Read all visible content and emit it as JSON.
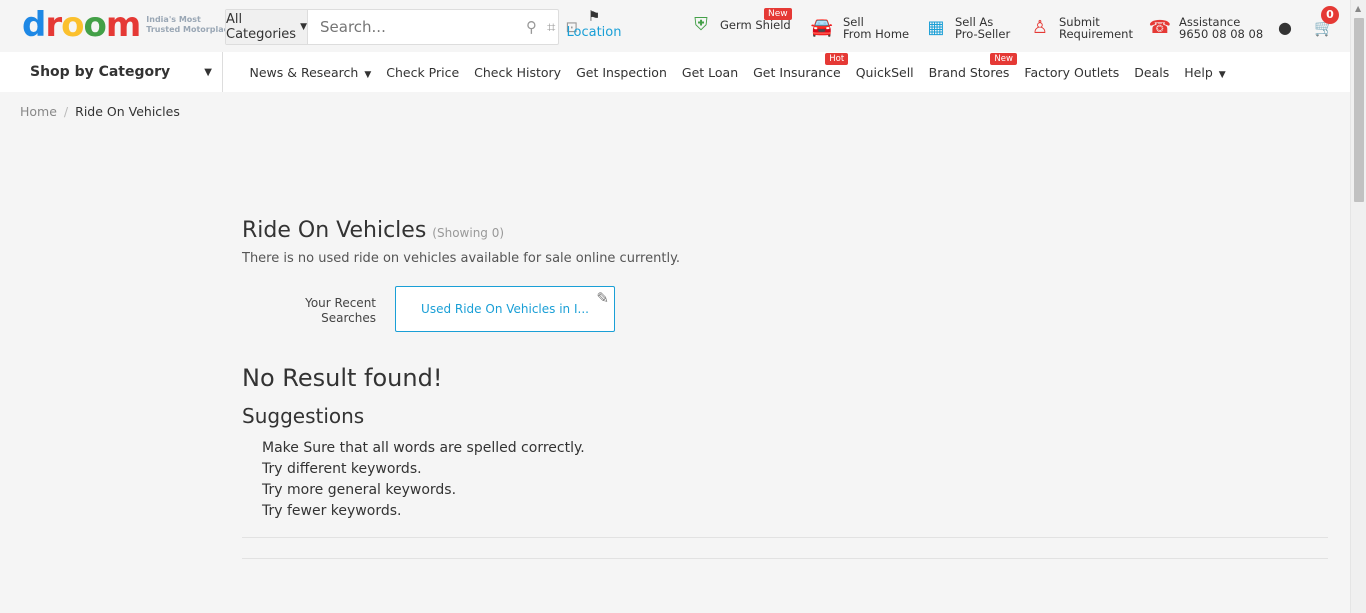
{
  "header": {
    "logo_text": "droom",
    "logo_tagline": "India's Most Trusted Motorplace",
    "search": {
      "category_label": "All Categories",
      "placeholder": "Search..."
    },
    "location_label": "Location",
    "items": [
      {
        "line1": "Germ Shield",
        "line2": "",
        "badge": "New"
      },
      {
        "line1": "Sell",
        "line2": "From Home",
        "badge": ""
      },
      {
        "line1": "Sell As",
        "line2": "Pro-Seller",
        "badge": ""
      },
      {
        "line1": "Submit",
        "line2": "Requirement",
        "badge": ""
      },
      {
        "line1": "Assistance",
        "line2": "9650 08 08 08",
        "badge": ""
      }
    ],
    "cart_count": "0"
  },
  "nav": {
    "shop_by_category": "Shop by Category",
    "items": [
      {
        "label": "News & Research",
        "badge": ""
      },
      {
        "label": "Check Price",
        "badge": ""
      },
      {
        "label": "Check History",
        "badge": ""
      },
      {
        "label": "Get Inspection",
        "badge": ""
      },
      {
        "label": "Get Loan",
        "badge": ""
      },
      {
        "label": "Get Insurance",
        "badge": "Hot"
      },
      {
        "label": "QuickSell",
        "badge": ""
      },
      {
        "label": "Brand Stores",
        "badge": "New"
      },
      {
        "label": "Factory Outlets",
        "badge": ""
      },
      {
        "label": "Deals",
        "badge": ""
      },
      {
        "label": "Help",
        "badge": ""
      }
    ]
  },
  "breadcrumb": {
    "home": "Home",
    "separator": "/",
    "current": "Ride On Vehicles"
  },
  "main": {
    "title": "Ride On Vehicles",
    "showing": "(Showing 0)",
    "subtext": "There is no used ride on vehicles available for sale online currently.",
    "recent_label": "Your Recent Searches",
    "recent_search": "Used Ride On Vehicles in I...",
    "no_result": "No Result found!",
    "suggestions_title": "Suggestions",
    "suggestions": [
      "Make Sure that all words are spelled correctly.",
      "Try different keywords.",
      "Try more general keywords.",
      "Try fewer keywords."
    ]
  }
}
